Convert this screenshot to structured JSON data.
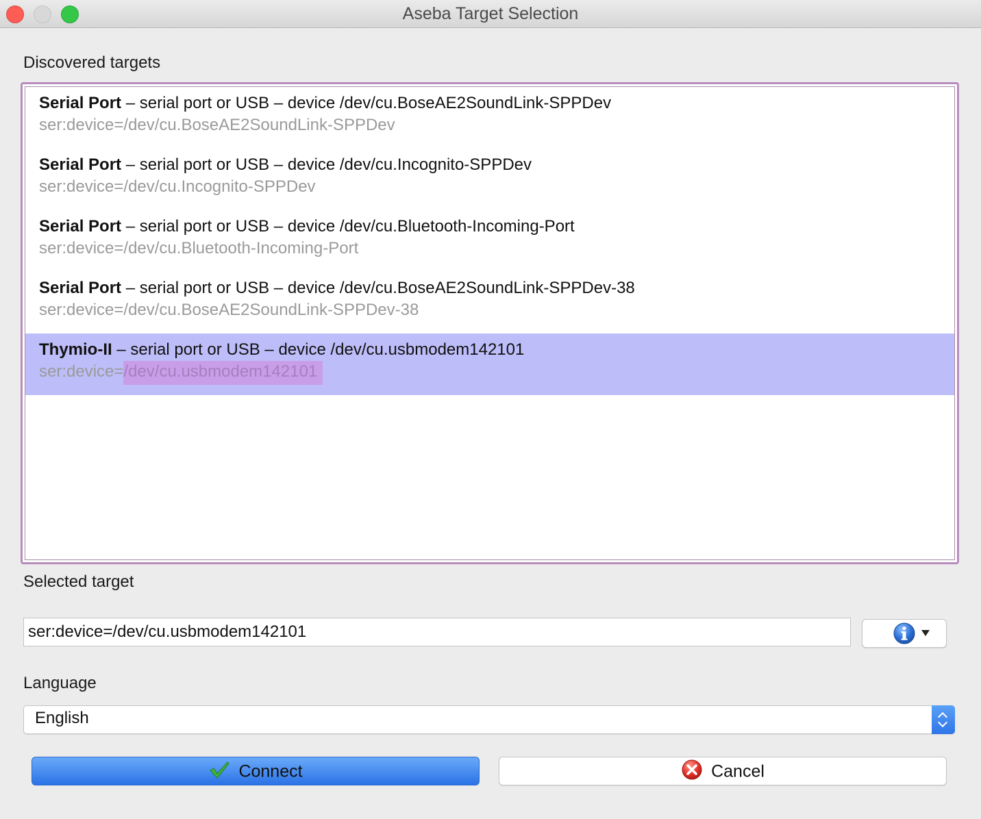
{
  "window": {
    "title": "Aseba Target Selection"
  },
  "discovered": {
    "label": "Discovered targets",
    "items": [
      {
        "name": "Serial Port",
        "description": " – serial port or USB – device /dev/cu.BoseAE2SoundLink-SPPDev",
        "target": "ser:device=/dev/cu.BoseAE2SoundLink-SPPDev"
      },
      {
        "name": "Serial Port",
        "description": " – serial port or USB – device /dev/cu.Incognito-SPPDev",
        "target": "ser:device=/dev/cu.Incognito-SPPDev"
      },
      {
        "name": "Serial Port",
        "description": " – serial port or USB – device /dev/cu.Bluetooth-Incoming-Port",
        "target": "ser:device=/dev/cu.Bluetooth-Incoming-Port"
      },
      {
        "name": "Serial Port",
        "description": " – serial port or USB – device /dev/cu.BoseAE2SoundLink-SPPDev-38",
        "target": "ser:device=/dev/cu.BoseAE2SoundLink-SPPDev-38"
      },
      {
        "name": "Thymio-II",
        "description": " – serial port or USB – device /dev/cu.usbmodem142101",
        "target_prefix": "ser:device=",
        "target_highlight": "/dev/cu.usbmodem142101",
        "selected": true
      }
    ]
  },
  "selected_target": {
    "label": "Selected target",
    "value": "ser:device=/dev/cu.usbmodem142101"
  },
  "info_button": {
    "icon": "info-icon"
  },
  "language": {
    "label": "Language",
    "value": "English"
  },
  "buttons": {
    "connect_label": "Connect",
    "cancel_label": "Cancel"
  },
  "colors": {
    "selection": "#bdbdf9",
    "list_border": "#b88bbd",
    "accent_blue": "#2b73e6"
  }
}
